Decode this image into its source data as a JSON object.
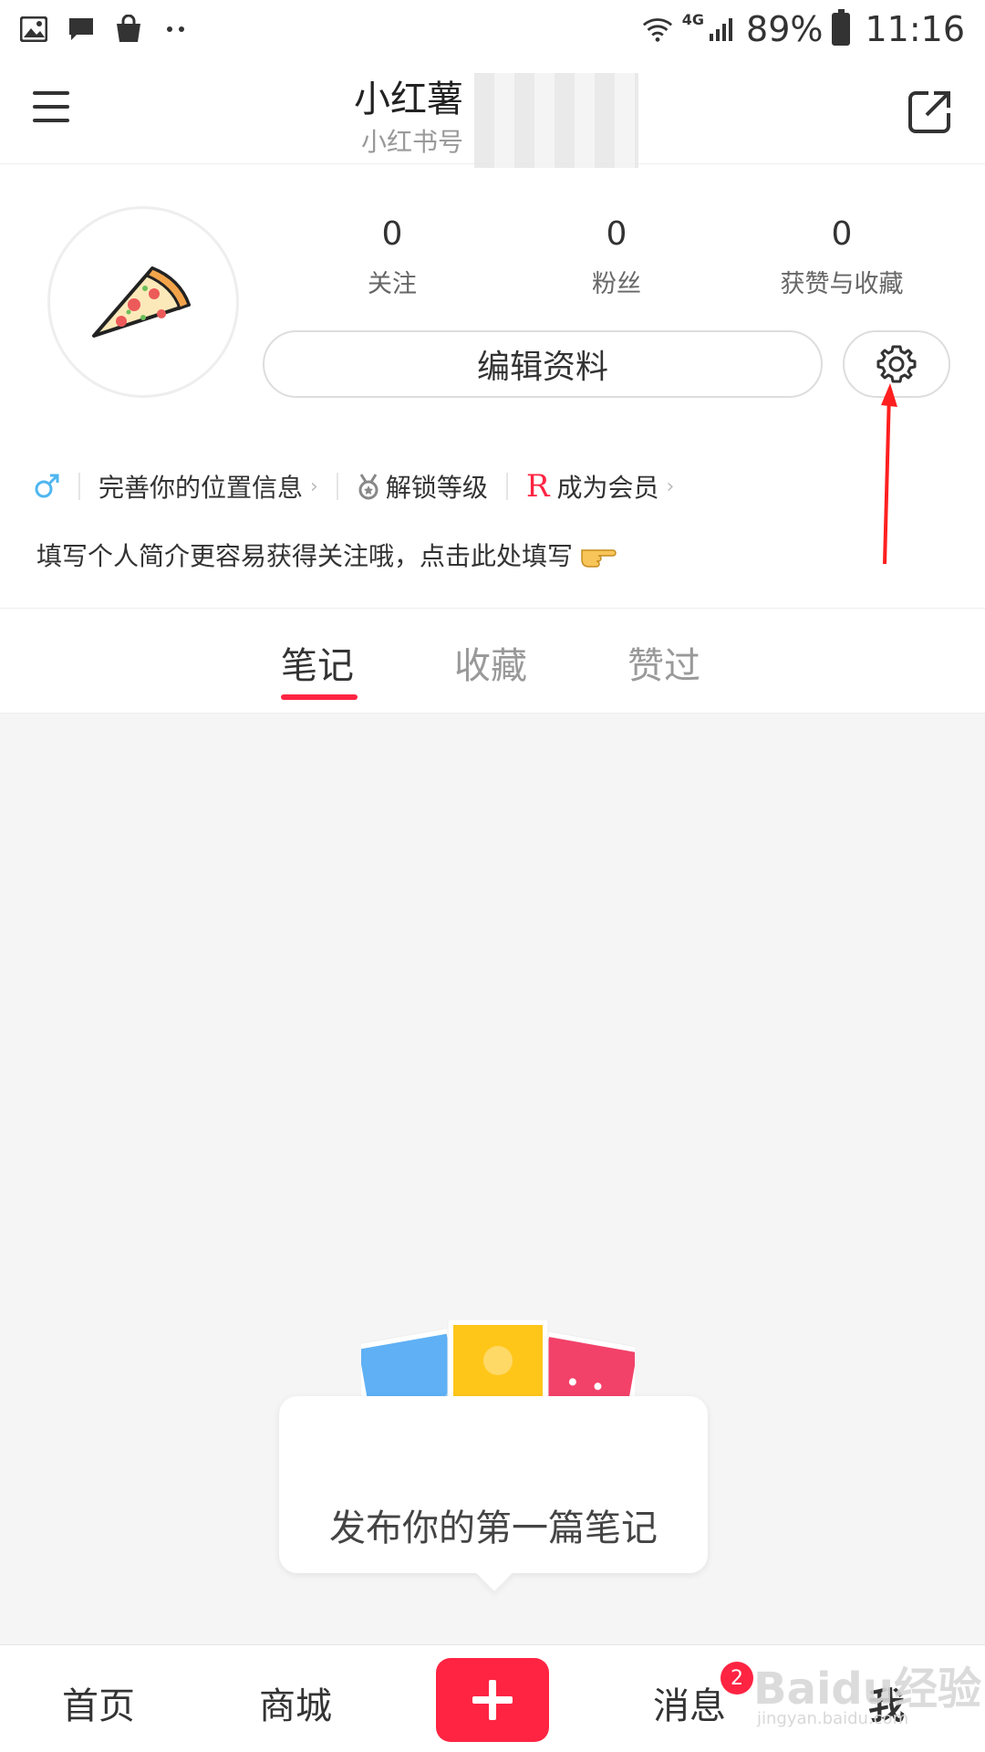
{
  "status_bar": {
    "battery": "89%",
    "time": "11:16",
    "network": "4G",
    "icons": [
      "gallery-icon",
      "message-icon",
      "shopping-bag-icon",
      "more-dots-icon",
      "wifi-icon",
      "signal-icon",
      "battery-icon"
    ]
  },
  "header": {
    "title": "小红薯",
    "subtitle": "小红书号"
  },
  "profile": {
    "stats": [
      {
        "value": "0",
        "label": "关注"
      },
      {
        "value": "0",
        "label": "粉丝"
      },
      {
        "value": "0",
        "label": "获赞与收藏"
      }
    ],
    "edit_button": "编辑资料",
    "info_chips": [
      {
        "label": "完善你的位置信息"
      },
      {
        "label": "解锁等级"
      },
      {
        "label": "成为会员",
        "icon_text": "R"
      }
    ],
    "bio": "填写个人简介更容易获得关注哦，点击此处填写"
  },
  "tabs": [
    {
      "label": "笔记",
      "active": true
    },
    {
      "label": "收藏",
      "active": false
    },
    {
      "label": "赞过",
      "active": false
    }
  ],
  "empty_state": {
    "text": "发布你的第一篇笔记"
  },
  "bottom_nav": {
    "items": [
      {
        "label": "首页"
      },
      {
        "label": "商城"
      },
      {
        "label": "消息",
        "badge": "2"
      },
      {
        "label": "我"
      }
    ],
    "watermark": "Baidu经验",
    "watermark_sub": "jingyan.baidu.com"
  },
  "colors": {
    "accent": "#ff2442",
    "tab_inactive": "#999999",
    "background": "#f5f5f5",
    "gender_blue": "#4fb6f0"
  }
}
